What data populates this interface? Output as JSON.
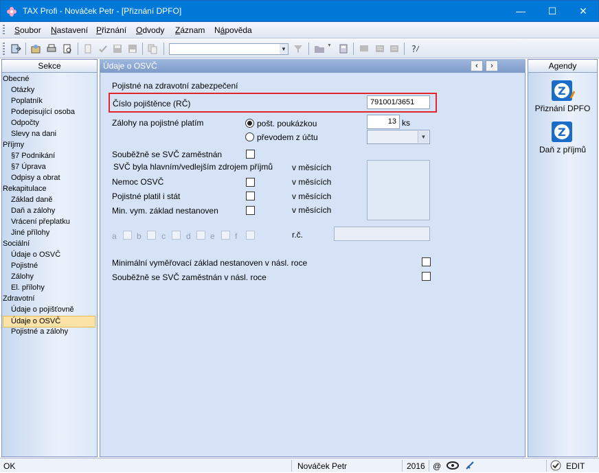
{
  "window": {
    "title": "TAX Profi - Nováček Petr - [Přiznání DPFO]"
  },
  "menu": [
    {
      "pre": "",
      "u": "S",
      "post": "oubor"
    },
    {
      "pre": "",
      "u": "N",
      "post": "astavení"
    },
    {
      "pre": "",
      "u": "P",
      "post": "řiznání"
    },
    {
      "pre": "",
      "u": "O",
      "post": "dvody"
    },
    {
      "pre": "",
      "u": "Z",
      "post": "áznam"
    },
    {
      "pre": "N",
      "u": "á",
      "post": "pověda"
    }
  ],
  "sections": {
    "title": "Sekce",
    "items": [
      {
        "label": "Obecné",
        "level": 0
      },
      {
        "label": "Otázky",
        "level": 1
      },
      {
        "label": "Poplatník",
        "level": 1
      },
      {
        "label": "Podepisující osoba",
        "level": 1
      },
      {
        "label": "Odpočty",
        "level": 1
      },
      {
        "label": "Slevy na dani",
        "level": 1
      },
      {
        "label": "Příjmy",
        "level": 0
      },
      {
        "label": "§7 Podnikání",
        "level": 1
      },
      {
        "label": "§7 Úprava",
        "level": 1
      },
      {
        "label": "Odpisy a obrat",
        "level": 1
      },
      {
        "label": "Rekapitulace",
        "level": 0
      },
      {
        "label": "Základ daně",
        "level": 1
      },
      {
        "label": "Daň a zálohy",
        "level": 1
      },
      {
        "label": "Vrácení přeplatku",
        "level": 1
      },
      {
        "label": "Jiné přílohy",
        "level": 1
      },
      {
        "label": "Sociální",
        "level": 0
      },
      {
        "label": "Údaje o OSVČ",
        "level": 1
      },
      {
        "label": "Pojistné",
        "level": 1
      },
      {
        "label": "Zálohy",
        "level": 1
      },
      {
        "label": "El. přílohy",
        "level": 1
      },
      {
        "label": "Zdravotní",
        "level": 0
      },
      {
        "label": "Údaje o pojišťovně",
        "level": 1
      },
      {
        "label": "Údaje o OSVČ",
        "level": 1,
        "active": true
      },
      {
        "label": "Pojistné a zálohy",
        "level": 1
      }
    ]
  },
  "main": {
    "title": "Údaje o OSVČ",
    "section_title": "Pojistné na zdravotní zabezpečení",
    "insurance_number_label": "Číslo pojištěnce (RČ)",
    "insurance_number_value": "791001/3651",
    "advances_label": "Zálohy na pojistné platím",
    "radio_postal": "pošt. poukázkou",
    "radio_transfer": "převodem z účtu",
    "ks_value": "13",
    "ks_label": "ks",
    "concurrent_label": "Souběžně se SVČ zaměstnán",
    "svc_main_label": "SVČ byla hlavním/vedlejším zdrojem příjmů",
    "in_months_1": "v měsících",
    "illness_label": "Nemoc OSVČ",
    "in_months_2": "v měsících",
    "state_payer_label": "Pojistné platil i stát",
    "in_months_3": "v měsících",
    "min_base_label": "Min. vym. základ nestanoven",
    "in_months_4": "v měsících",
    "letters": [
      "a",
      "b",
      "c",
      "d",
      "e",
      "f"
    ],
    "rc_label": "r.č.",
    "next_min_base_label": "Minimální vyměřovací základ nestanoven v násl. roce",
    "next_concurrent_label": "Souběžně se SVČ zaměstnán v násl. roce"
  },
  "agendas": {
    "title": "Agendy",
    "items": [
      "Přiznání DPFO",
      "Daň z příjmů"
    ]
  },
  "status": {
    "left": "OK",
    "user": "Nováček Petr",
    "year": "2016",
    "at": "@",
    "mode": "EDIT"
  },
  "colors": {
    "accent": "#0078d7",
    "highlight_border": "#e3242b",
    "active_item": "#fbe3a8"
  }
}
